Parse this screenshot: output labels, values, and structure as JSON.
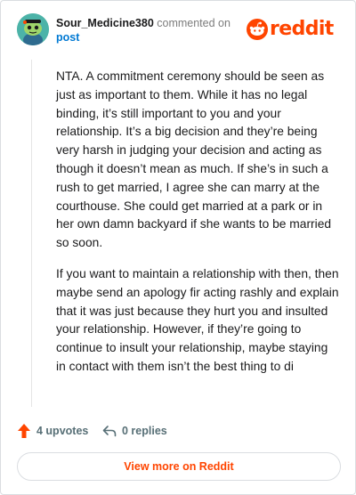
{
  "author": {
    "username": "Sour_Medicine380",
    "action_text": "commented on",
    "target_link": "post"
  },
  "brand": {
    "name": "reddit",
    "accent": "#ff4500"
  },
  "comment": {
    "paragraphs": [
      "NTA. A commitment ceremony should be seen as just as important to them. While it has no legal binding, it’s still important to you and your relationship. It’s a big decision and they’re being very harsh in judging your decision and acting as though it doesn’t mean as much. If she’s in such a rush to get married, I agree she can marry at the courthouse. She could get married at a park or in her own damn backyard if she wants to be married so soon.",
      "If you want to maintain a relationship with then, then maybe send an apology fir acting rashly and explain that it was just because they hurt you and insulted your relationship. However, if they’re going to continue to insult your relationship, maybe staying in contact with them isn’t the best thing to di"
    ]
  },
  "actions": {
    "upvotes_label": "4 upvotes",
    "upvote_icon": "upvote-arrow-icon",
    "replies_label": "0 replies",
    "reply_icon": "reply-icon"
  },
  "footer": {
    "view_more_label": "View more on Reddit"
  }
}
